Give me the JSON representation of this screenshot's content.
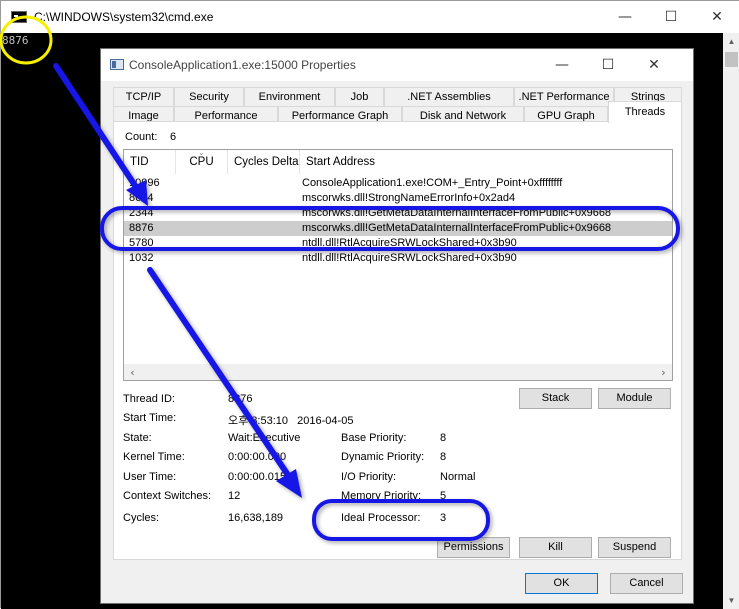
{
  "cmd": {
    "title": "C:\\WINDOWS\\system32\\cmd.exe",
    "output": "8876",
    "minimize": "—",
    "maximize": "☐",
    "close": "✕"
  },
  "dialog": {
    "title": "ConsoleApplication1.exe:15000 Properties",
    "minimize": "—",
    "maximize": "☐",
    "close": "✕",
    "tabs_row1": [
      "TCP/IP",
      "Security",
      "Environment",
      "Job",
      ".NET Assemblies",
      ".NET Performance",
      "Strings"
    ],
    "tabs_row2": [
      "Image",
      "Performance",
      "Performance Graph",
      "Disk and Network",
      "GPU Graph",
      "Threads"
    ],
    "count_label": "Count:",
    "count_value": "6",
    "columns": [
      "TID",
      "CPU",
      "Cycles Delta",
      "Start Address"
    ],
    "rows": [
      {
        "tid": "10996",
        "address": "ConsoleApplication1.exe!COM+_Entry_Point+0xffffffff"
      },
      {
        "tid": "8624",
        "address": "mscorwks.dll!StrongNameErrorInfo+0x2ad4"
      },
      {
        "tid": "2344",
        "address": "mscorwks.dll!GetMetaDataInternalInterfaceFromPublic+0x9668"
      },
      {
        "tid": "8876",
        "address": "mscorwks.dll!GetMetaDataInternalInterfaceFromPublic+0x9668"
      },
      {
        "tid": "5780",
        "address": "ntdll.dll!RtlAcquireSRWLockShared+0x3b90"
      },
      {
        "tid": "1032",
        "address": "ntdll.dll!RtlAcquireSRWLockShared+0x3b90"
      }
    ],
    "details": {
      "thread_id_label": "Thread ID:",
      "thread_id_value": "8876",
      "start_time_label": "Start Time:",
      "start_time_value": "오후 8:53:10   2016-04-05",
      "state_label": "State:",
      "state_value": "Wait:Executive",
      "kernel_time_label": "Kernel Time:",
      "kernel_time_value": "0:00:00.000",
      "user_time_label": "User Time:",
      "user_time_value": "0:00:00.015",
      "context_switches_label": "Context Switches:",
      "context_switches_value": "12",
      "cycles_label": "Cycles:",
      "cycles_value": "16,638,189",
      "base_priority_label": "Base Priority:",
      "base_priority_value": "8",
      "dynamic_priority_label": "Dynamic Priority:",
      "dynamic_priority_value": "8",
      "io_priority_label": "I/O Priority:",
      "io_priority_value": "Normal",
      "memory_priority_label": "Memory Priority:",
      "memory_priority_value": "5",
      "ideal_processor_label": "Ideal Processor:",
      "ideal_processor_value": "3"
    },
    "buttons": {
      "stack": "Stack",
      "module": "Module",
      "permissions": "Permissions",
      "kill": "Kill",
      "suspend": "Suspend",
      "ok": "OK",
      "cancel": "Cancel"
    }
  },
  "colors": {
    "annotation_blue": "#1414e6",
    "annotation_yellow": "#f5f000",
    "selection": "#cdcdcd"
  }
}
